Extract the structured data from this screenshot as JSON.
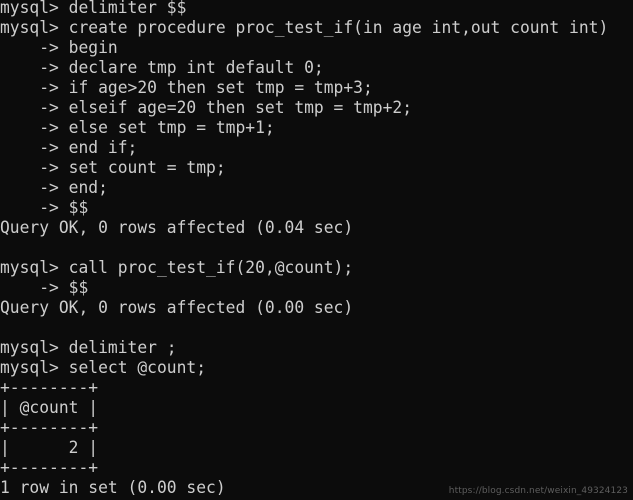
{
  "terminal": {
    "title": "mysql client session",
    "background_color": "#0c0c0c",
    "foreground_color": "#cdcdcd",
    "prompt": "mysql>",
    "continuation_prompt": "->",
    "lines": [
      "mysql> delimiter $$",
      "mysql> create procedure proc_test_if(in age int,out count int)",
      "    -> begin",
      "    -> declare tmp int default 0;",
      "    -> if age>20 then set tmp = tmp+3;",
      "    -> elseif age=20 then set tmp = tmp+2;",
      "    -> else set tmp = tmp+1;",
      "    -> end if;",
      "    -> set count = tmp;",
      "    -> end;",
      "    -> $$",
      "Query OK, 0 rows affected (0.04 sec)",
      "",
      "mysql> call proc_test_if(20,@count);",
      "    -> $$",
      "Query OK, 0 rows affected (0.00 sec)",
      "",
      "mysql> delimiter ;",
      "mysql> select @count;",
      "+--------+",
      "| @count |",
      "+--------+",
      "|      2 |",
      "+--------+",
      "1 row in set (0.00 sec)"
    ],
    "result_table": {
      "columns": [
        "@count"
      ],
      "rows": [
        [
          "2"
        ]
      ],
      "row_count_status": "1 row in set (0.00 sec)"
    },
    "statuses": [
      "Query OK, 0 rows affected (0.04 sec)",
      "Query OK, 0 rows affected (0.00 sec)",
      "1 row in set (0.00 sec)"
    ]
  },
  "watermark": {
    "text": "https://blog.csdn.net/weixin_49324123",
    "color": "#5e5e5e"
  }
}
